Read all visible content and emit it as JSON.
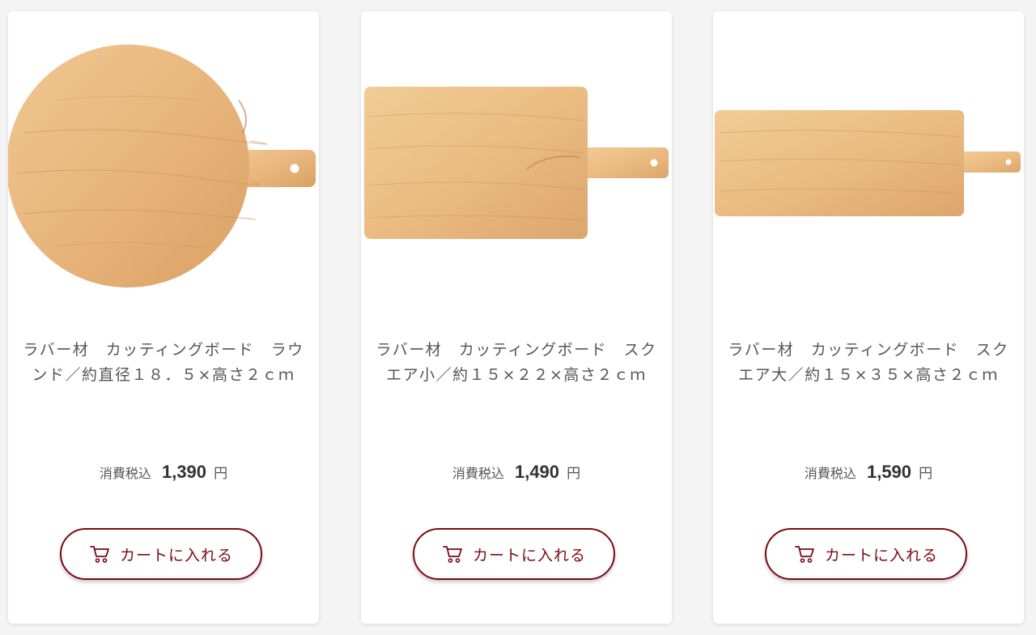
{
  "colors": {
    "accent": "#7a0a14",
    "wood_light": "#ecc08a",
    "wood_dark": "#d9a468"
  },
  "products": [
    {
      "name": "ラバー材　カッティングボード　ラウンド／約直径１８．５×高さ２ｃｍ",
      "price_prefix": "消費税込",
      "price": "1,390",
      "price_unit": "円",
      "cart_label": "カートに入れる",
      "cart_icon": "cart-icon"
    },
    {
      "name": "ラバー材　カッティングボード　スクエア小／約１５×２２×高さ２ｃｍ",
      "price_prefix": "消費税込",
      "price": "1,490",
      "price_unit": "円",
      "cart_label": "カートに入れる",
      "cart_icon": "cart-icon"
    },
    {
      "name": "ラバー材　カッティングボード　スクエア大／約１５×３５×高さ２ｃｍ",
      "price_prefix": "消費税込",
      "price": "1,590",
      "price_unit": "円",
      "cart_label": "カートに入れる",
      "cart_icon": "cart-icon"
    }
  ]
}
